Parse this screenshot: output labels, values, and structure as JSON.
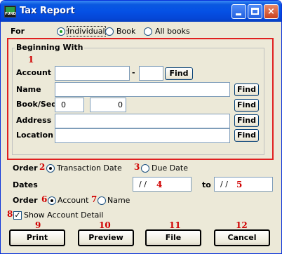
{
  "window": {
    "title": "Tax Report",
    "app_icon_text": "FUND",
    "minimize_label": "minimize",
    "maximize_label": "maximize",
    "close_label": "×"
  },
  "for_section": {
    "label": "For",
    "options": [
      "Individual",
      "Book",
      "All books"
    ],
    "selected": "Individual"
  },
  "beginning_with": {
    "caption": "Beginning With",
    "marker": "1",
    "account": {
      "label": "Account",
      "value1": "",
      "dash": "-",
      "value2": "",
      "find": "Find"
    },
    "name": {
      "label": "Name",
      "value": "",
      "find": "Find"
    },
    "book_seq": {
      "label": "Book/Seq",
      "book": "0",
      "seq": "0",
      "find": "Find"
    },
    "address": {
      "label": "Address",
      "value": "",
      "find": "Find"
    },
    "location": {
      "label": "Location",
      "value": "",
      "find": "Find"
    }
  },
  "order1": {
    "label": "Order",
    "marker_transaction": "2",
    "marker_due": "3",
    "options": [
      "Transaction Date",
      "Due Date"
    ],
    "selected": "Transaction Date"
  },
  "dates": {
    "label": "Dates",
    "from": "/ /",
    "from_marker": "4",
    "to_label": "to",
    "to": "/ /",
    "to_marker": "5"
  },
  "order2": {
    "label": "Order",
    "marker_account": "6",
    "marker_name": "7",
    "options": [
      "Account",
      "Name"
    ],
    "selected": "Account"
  },
  "show_detail": {
    "marker": "8",
    "label": "Show Account Detail",
    "checked": true,
    "check_glyph": "✓"
  },
  "buttons": {
    "print": {
      "marker": "9",
      "label": "Print"
    },
    "preview": {
      "marker": "10",
      "label": "Preview"
    },
    "file": {
      "marker": "11",
      "label": "File"
    },
    "cancel": {
      "marker": "12",
      "label": "Cancel"
    }
  },
  "colors": {
    "title_bar": "#0551e5",
    "window_bg": "#ece9d8",
    "annotation_red": "#d00000",
    "radio_dot": "#21a121"
  }
}
